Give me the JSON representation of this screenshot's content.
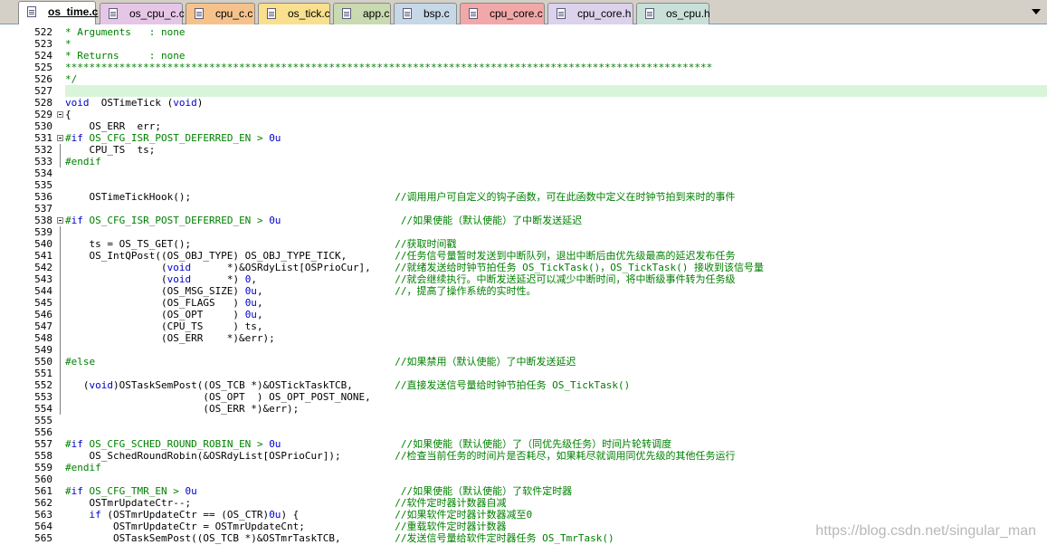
{
  "tabs": [
    {
      "label": "os_time.c",
      "color": "#ffffff",
      "active": true
    },
    {
      "label": "os_cpu_c.c",
      "color": "#e6c6e6",
      "active": false
    },
    {
      "label": "cpu_c.c",
      "color": "#f5c28c",
      "active": false
    },
    {
      "label": "os_tick.c",
      "color": "#f8e08e",
      "active": false
    },
    {
      "label": "app.c",
      "color": "#c9d9b0",
      "active": false
    },
    {
      "label": "bsp.c",
      "color": "#c6d7e6",
      "active": false
    },
    {
      "label": "cpu_core.c",
      "color": "#f2a8a8",
      "active": false
    },
    {
      "label": "cpu_core.h",
      "color": "#dcd2ec",
      "active": false
    },
    {
      "label": "os_cpu.h",
      "color": "#c9e0d8",
      "active": false
    }
  ],
  "code": {
    "lines": [
      {
        "n": "522",
        "text": "* Arguments   : none",
        "cls": "cm"
      },
      {
        "n": "523",
        "text": "*",
        "cls": "cm"
      },
      {
        "n": "524",
        "text": "* Returns     : none",
        "cls": "cm"
      },
      {
        "n": "525",
        "text": "************************************************************************************************************",
        "cls": "cm"
      },
      {
        "n": "526",
        "text": "*/",
        "cls": "cm"
      },
      {
        "n": "527",
        "text": "",
        "cls": "",
        "hl": true
      },
      {
        "n": "528",
        "text": "void  OSTimeTick (void)",
        "cls": "kwline"
      },
      {
        "n": "529",
        "text": "{",
        "cls": ""
      },
      {
        "n": "530",
        "text": "    OS_ERR  err;",
        "cls": ""
      },
      {
        "n": "531",
        "text": "#if OS_CFG_ISR_POST_DEFERRED_EN > 0u",
        "cls": "pp"
      },
      {
        "n": "532",
        "text": "    CPU_TS  ts;",
        "cls": ""
      },
      {
        "n": "533",
        "text": "#endif",
        "cls": "pp"
      },
      {
        "n": "534",
        "text": "",
        "cls": ""
      },
      {
        "n": "535",
        "text": "",
        "cls": ""
      },
      {
        "n": "536",
        "text": "    OSTimeTickHook();                                  //调用用户可自定义的钩子函数，可在此函数中定义在时钟节拍到来时的事件",
        "cls": "mix"
      },
      {
        "n": "537",
        "text": "",
        "cls": ""
      },
      {
        "n": "538",
        "text": "#if OS_CFG_ISR_POST_DEFERRED_EN > 0u                    //如果使能（默认使能）了中断发送延迟",
        "cls": "pp"
      },
      {
        "n": "539",
        "text": "",
        "cls": ""
      },
      {
        "n": "540",
        "text": "    ts = OS_TS_GET();                                  //获取时间戳",
        "cls": "mix"
      },
      {
        "n": "541",
        "text": "    OS_IntQPost((OS_OBJ_TYPE) OS_OBJ_TYPE_TICK,        //任务信号量暂时发送到中断队列，退出中断后由优先级最高的延迟发布任务",
        "cls": "mix"
      },
      {
        "n": "542",
        "text": "                (void      *)&OSRdyList[OSPrioCur],    //就绪发送给时钟节拍任务 OS_TickTask()，OS_TickTask() 接收到该信号量",
        "cls": "mix"
      },
      {
        "n": "543",
        "text": "                (void      *) 0,                       //就会继续执行。中断发送延迟可以减少中断时间，将中断级事件转为任务级",
        "cls": "mix"
      },
      {
        "n": "544",
        "text": "                (OS_MSG_SIZE) 0u,                      //，提高了操作系统的实时性。",
        "cls": "mix"
      },
      {
        "n": "545",
        "text": "                (OS_FLAGS   ) 0u,",
        "cls": ""
      },
      {
        "n": "546",
        "text": "                (OS_OPT     ) 0u,",
        "cls": ""
      },
      {
        "n": "547",
        "text": "                (CPU_TS     ) ts,",
        "cls": ""
      },
      {
        "n": "548",
        "text": "                (OS_ERR    *)&err);",
        "cls": ""
      },
      {
        "n": "549",
        "text": "",
        "cls": ""
      },
      {
        "n": "550",
        "text": "#else                                                  //如果禁用（默认使能）了中断发送延迟",
        "cls": "pp"
      },
      {
        "n": "551",
        "text": "",
        "cls": ""
      },
      {
        "n": "552",
        "text": "   (void)OSTaskSemPost((OS_TCB *)&OSTickTaskTCB,       //直接发送信号量给时钟节拍任务 OS_TickTask()",
        "cls": "mix"
      },
      {
        "n": "553",
        "text": "                       (OS_OPT  ) OS_OPT_POST_NONE,",
        "cls": ""
      },
      {
        "n": "554",
        "text": "                       (OS_ERR *)&err);",
        "cls": ""
      },
      {
        "n": "555",
        "text": "",
        "cls": ""
      },
      {
        "n": "556",
        "text": "",
        "cls": ""
      },
      {
        "n": "557",
        "text": "#if OS_CFG_SCHED_ROUND_ROBIN_EN > 0u                    //如果使能（默认使能）了（同优先级任务）时间片轮转调度",
        "cls": "pp"
      },
      {
        "n": "558",
        "text": "    OS_SchedRoundRobin(&OSRdyList[OSPrioCur]);         //检查当前任务的时间片是否耗尽，如果耗尽就调用同优先级的其他任务运行",
        "cls": "mix"
      },
      {
        "n": "559",
        "text": "#endif",
        "cls": "pp"
      },
      {
        "n": "560",
        "text": "",
        "cls": ""
      },
      {
        "n": "561",
        "text": "#if OS_CFG_TMR_EN > 0u                                  //如果使能（默认使能）了软件定时器",
        "cls": "pp"
      },
      {
        "n": "562",
        "text": "    OSTmrUpdateCtr--;                                  //软件定时器计数器自减",
        "cls": "mix"
      },
      {
        "n": "563",
        "text": "    if (OSTmrUpdateCtr == (OS_CTR)0u) {                //如果软件定时器计数器减至0",
        "cls": "mix"
      },
      {
        "n": "564",
        "text": "        OSTmrUpdateCtr = OSTmrUpdateCnt;               //重载软件定时器计数器",
        "cls": "mix"
      },
      {
        "n": "565",
        "text": "        OSTaskSemPost((OS_TCB *)&OSTmrTaskTCB,         //发送信号量给软件定时器任务 OS_TmrTask()",
        "cls": "mix"
      }
    ]
  },
  "watermark": "https://blog.csdn.net/singular_man"
}
